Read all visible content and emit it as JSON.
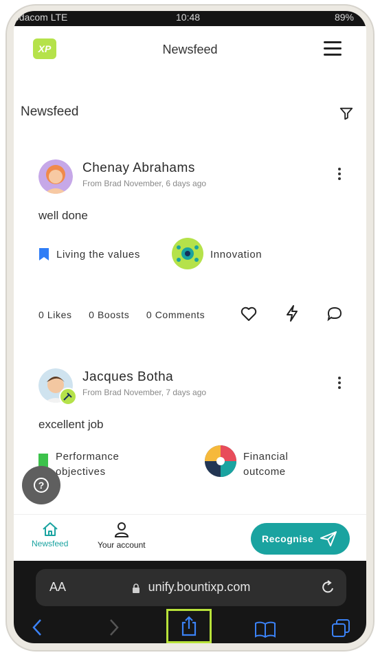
{
  "status": {
    "carrier": "odacom LTE",
    "time": "10:48",
    "battery": "89%"
  },
  "header": {
    "logo_text": "XP",
    "title": "Newsfeed",
    "menu_icon": "hamburger-icon"
  },
  "feed": {
    "title": "Newsfeed",
    "filter_icon": "filter-icon",
    "posts": [
      {
        "name": "Chenay Abrahams",
        "meta": "From Brad November, 6 days ago",
        "message": "well done",
        "tags": [
          "Living the values",
          "Innovation"
        ],
        "likes": "0 Likes",
        "boosts": "0 Boosts",
        "comments": "0 Comments"
      },
      {
        "name": "Jacques Botha",
        "meta": "From Brad November, 7 days ago",
        "message": "excellent job",
        "tags": [
          "Performance objectives",
          "Financial outcome"
        ]
      }
    ]
  },
  "help": {
    "label": "?"
  },
  "bottom_nav": {
    "items": [
      {
        "label": "Newsfeed",
        "icon": "home-icon",
        "active": true
      },
      {
        "label": "Your account",
        "icon": "person-icon",
        "active": false
      }
    ],
    "recognise_label": "Recognise"
  },
  "browser": {
    "aa_label": "AA",
    "url": "unify.bountixp.com"
  },
  "colors": {
    "accent": "#1aa3a0",
    "active_nav": "#1aa3a0",
    "logo": "#b5e24a",
    "highlight": "#b8e23a",
    "bookmark": "#2f7df6"
  }
}
